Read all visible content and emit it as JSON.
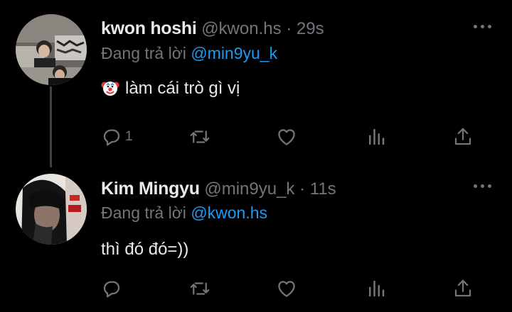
{
  "tweets": [
    {
      "display_name": "kwon hoshi",
      "handle": "@kwon.hs",
      "time": "· 29s",
      "replying_prefix": "Đang trả lời",
      "replying_to": "@min9yu_k",
      "text": "làm cái trò gì vị",
      "emoji": "clown-face",
      "reply_count": "1"
    },
    {
      "display_name": "Kim Mingyu",
      "handle": "@min9yu_k",
      "time": "· 11s",
      "replying_prefix": "Đang trả lời",
      "replying_to": "@kwon.hs",
      "text": "thì đó đó=))",
      "reply_count": ""
    }
  ],
  "colors": {
    "background": "#000000",
    "text": "#e7e9ea",
    "muted": "#71767b",
    "link": "#1d9bf0"
  },
  "icons": [
    "reply-icon",
    "retweet-icon",
    "like-icon",
    "views-icon",
    "share-icon",
    "more-icon"
  ]
}
